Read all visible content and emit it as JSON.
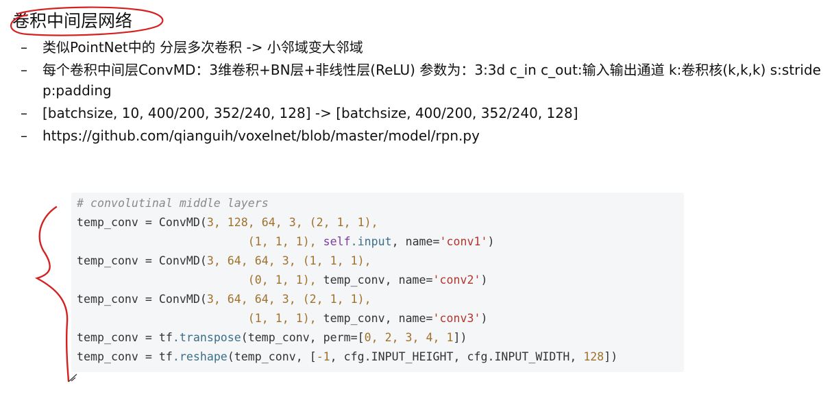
{
  "slide": {
    "title": "卷积中间层网络"
  },
  "bullets": [
    {
      "dash": "–",
      "text": "类似PointNet中的 分层多次卷积 -> 小邻域变大邻域"
    },
    {
      "dash": "–",
      "text": "每个卷积中间层ConvMD：3维卷积+BN层+非线性层(ReLU)   参数为：3:3d  c_in c_out:输入输出通道 k:卷积核(k,k,k) s:stride p:padding"
    },
    {
      "dash": "–",
      "text": "[batchsize, 10, 400/200, 352/240, 128]  -> [batchsize, 400/200, 352/240, 128]"
    },
    {
      "dash": "–",
      "text": "https://github.com/qianguih/voxelnet/blob/master/model/rpn.py"
    }
  ],
  "code": {
    "comment": "# convolutinal middle layers",
    "l1_var": "temp_conv",
    "l1_rest": " = ConvMD(",
    "l1_nums": "3, 128, 64, 3, (2, 1, 1),",
    "l2_pad": "                         ",
    "l2_nums": "(1, 1, 1), ",
    "l2_self": "self",
    "l2_input": ".input",
    "l2_name": ", name=",
    "l2_str": "'conv1'",
    "l2_close": ")",
    "l3_var": "temp_conv",
    "l3_rest": " = ConvMD(",
    "l3_nums": "3, 64, 64, 3, (1, 1, 1),",
    "l4_pad": "                         ",
    "l4_nums": "(0, 1, 1), ",
    "l4_arg": "temp_conv",
    "l4_name": ", name=",
    "l4_str": "'conv2'",
    "l4_close": ")",
    "l5_var": "temp_conv",
    "l5_rest": " = ConvMD(",
    "l5_nums": "3, 64, 64, 3, (2, 1, 1),",
    "l6_pad": "                         ",
    "l6_nums": "(1, 1, 1), ",
    "l6_arg": "temp_conv",
    "l6_name": ", name=",
    "l6_str": "'conv3'",
    "l6_close": ")",
    "l7_var": "temp_conv",
    "l7_eq": " = tf",
    "l7_fn": ".transpose",
    "l7_args": "(temp_conv, perm=[",
    "l7_nums": "0, 2, 3, 4, 1",
    "l7_close": "])",
    "l8_var": "temp_conv",
    "l8_eq": " = tf",
    "l8_fn": ".reshape",
    "l8_args": "(temp_conv, [",
    "l8_nums": "-1",
    "l8_mid": ", cfg.INPUT_HEIGHT, cfg.INPUT_WIDTH, ",
    "l8_num2": "128",
    "l8_close": "])"
  },
  "colors": {
    "annotation": "#d62020",
    "code_bg": "#f5f6f8",
    "number": "#a0712b",
    "string": "#b5352c"
  }
}
